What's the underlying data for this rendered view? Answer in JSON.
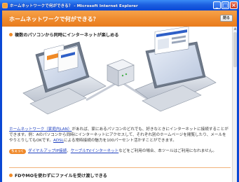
{
  "window": {
    "title": "ホームネットワークで何ができる？ - Microsoft Internet Explorer"
  },
  "header": {
    "title": "ホームネットワークで何ができる？",
    "close_label": "閉る"
  },
  "sections": [
    {
      "title": "複数のパソコンから同時にインターネットが楽しめる"
    },
    {
      "title": "FDやMOを使わずにファイルを受け渡しできる"
    }
  ],
  "paragraph": {
    "link": "ホームネットワーク（家庭内LAN）",
    "text": "があれば、家にあるパソコンのどれでも、好きなときにインターネットに接続することができます。例：Aのパソコンから同時にインターネットにアクセスして、それぞれ別のホームページを閲覧したり、メールをやりとりしてもOKです。",
    "link2": "ADSL",
    "text2": "による常時接続の魅力を100パーセント活かすことができます。"
  },
  "note": {
    "badge": "ちぇっく",
    "link1": "ダイヤルアップIP接続",
    "sep": "、",
    "link2": "ケーブルTVインターネット",
    "text": "などをご利用の場合、本ツールはご利用になれません。"
  },
  "colors": {
    "accent": "#ef8a2c",
    "link": "#1d3fbf",
    "titlebar": "#1c5fe0"
  }
}
